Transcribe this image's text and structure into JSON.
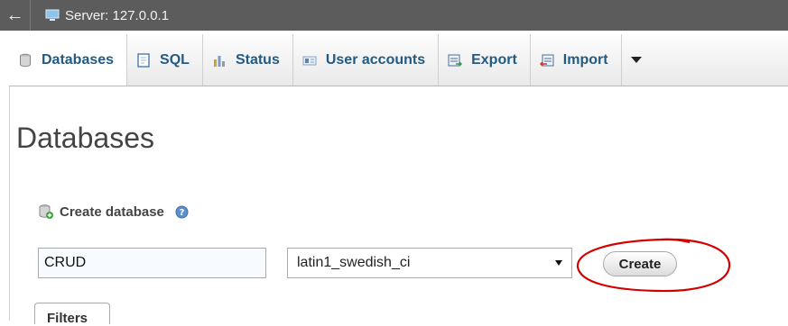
{
  "topbar": {
    "breadcrumb": "Server: 127.0.0.1"
  },
  "tabs": [
    {
      "label": "Databases",
      "icon": "database-icon"
    },
    {
      "label": "SQL",
      "icon": "sql-icon"
    },
    {
      "label": "Status",
      "icon": "status-chart-icon"
    },
    {
      "label": "User accounts",
      "icon": "user-accounts-icon"
    },
    {
      "label": "Export",
      "icon": "export-icon"
    },
    {
      "label": "Import",
      "icon": "import-icon"
    }
  ],
  "main": {
    "title": "Databases",
    "create": {
      "label": "Create database",
      "name_value": "CRUD",
      "collation_selected": "latin1_swedish_ci",
      "button_label": "Create"
    },
    "filters_label": "Filters"
  },
  "colors": {
    "topbar": "#5c5c5c",
    "tab_text": "#235a81",
    "annotation": "#d40000"
  }
}
